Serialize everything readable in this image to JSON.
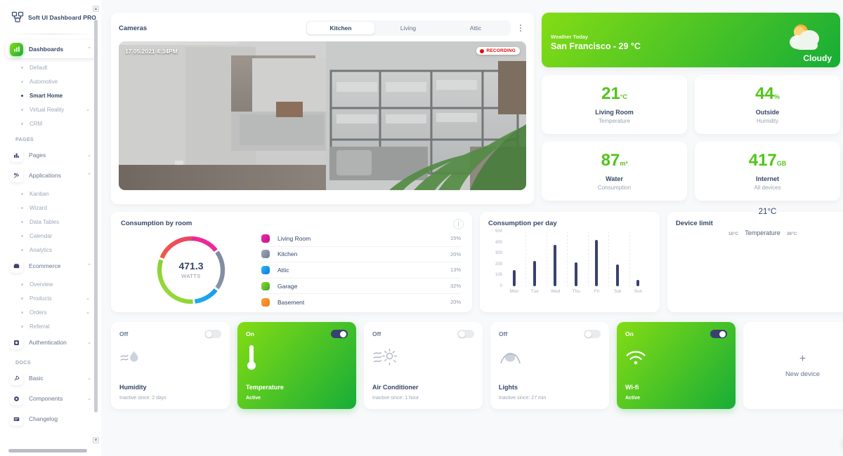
{
  "brand": {
    "name": "Soft UI Dashboard PRO",
    "logo_icon": "grid-logo-icon"
  },
  "sidebar": {
    "dashboards": {
      "label": "Dashboards",
      "icon": "dashboard-icon",
      "chevron": "⌃"
    },
    "dashboard_items": [
      {
        "label": "Default"
      },
      {
        "label": "Automotive"
      },
      {
        "label": "Smart Home"
      },
      {
        "label": "Virtual Reality",
        "chevron": "⌄"
      },
      {
        "label": "CRM"
      }
    ],
    "pages_section": "PAGES",
    "pages": {
      "label": "Pages",
      "icon": "pages-icon",
      "chevron": "⌄"
    },
    "applications": {
      "label": "Applications",
      "icon": "applications-icon",
      "chevron": "⌃"
    },
    "application_items": [
      {
        "label": "Kanban"
      },
      {
        "label": "Wizard"
      },
      {
        "label": "Data Tables"
      },
      {
        "label": "Calendar"
      },
      {
        "label": "Analytics"
      }
    ],
    "ecommerce": {
      "label": "Ecommerce",
      "icon": "ecommerce-icon",
      "chevron": "⌃"
    },
    "ecommerce_items": [
      {
        "label": "Overview"
      },
      {
        "label": "Products",
        "chevron": "⌄"
      },
      {
        "label": "Orders",
        "chevron": "⌄"
      },
      {
        "label": "Referral"
      }
    ],
    "authentication": {
      "label": "Authentication",
      "icon": "authentication-icon",
      "chevron": "⌄"
    },
    "docs_section": "DOCS",
    "basic": {
      "label": "Basic",
      "icon": "basic-icon",
      "chevron": "⌄"
    },
    "components": {
      "label": "Components",
      "icon": "components-icon",
      "chevron": "⌄"
    },
    "changelog": {
      "label": "Changelog",
      "icon": "changelog-icon"
    }
  },
  "cameras": {
    "title": "Cameras",
    "tabs": [
      {
        "label": "Kitchen",
        "active": true
      },
      {
        "label": "Living",
        "active": false
      },
      {
        "label": "Attic",
        "active": false
      }
    ],
    "timestamp": "17.05.2021 4:34PM",
    "recording_label": "RECORDING",
    "menu_icon": "kebab-menu-icon"
  },
  "weather": {
    "subtitle": "Weather Today",
    "headline": "San Francisco - 29 °C",
    "condition": "Cloudy",
    "icon": "sun-behind-cloud-icon",
    "accent": "#17ad37"
  },
  "stats": [
    {
      "value": "21",
      "unit": "°C",
      "name": "Living Room",
      "sub": "Temperature"
    },
    {
      "value": "44",
      "unit": "%",
      "name": "Outside",
      "sub": "Humidity"
    },
    {
      "value": "87",
      "unit": "m³",
      "name": "Water",
      "sub": "Consumption"
    },
    {
      "value": "417",
      "unit": "GB",
      "name": "Internet",
      "sub": "All devices"
    }
  ],
  "floating_temp": "21°C",
  "consumption_by_room": {
    "title": "Consumption by room",
    "info_icon": "info-icon",
    "center_value": "471.3",
    "center_unit": "WATTS"
  },
  "device_limit": {
    "title": "Device limit",
    "min": "16°C",
    "label": "Temperature",
    "max": "38°C"
  },
  "devices": [
    {
      "state": "Off",
      "on": false,
      "name": "Humidity",
      "note": "Inactive since: 2 days",
      "icon": "humidity-icon"
    },
    {
      "state": "On",
      "on": true,
      "name": "Temperature",
      "note": "Active",
      "icon": "thermometer-icon"
    },
    {
      "state": "Off",
      "on": false,
      "name": "Air Conditioner",
      "note": "Inactive since: 1 hour",
      "icon": "air-conditioner-icon"
    },
    {
      "state": "Off",
      "on": false,
      "name": "Lights",
      "note": "Inactive since: 27 min",
      "icon": "lights-icon"
    },
    {
      "state": "On",
      "on": true,
      "name": "Wi-fi",
      "note": "Active",
      "icon": "wifi-icon"
    }
  ],
  "new_device": {
    "label": "New device",
    "plus": "+"
  },
  "settings_fab": {
    "icon": "gear-icon"
  },
  "chart_data": [
    {
      "type": "pie",
      "title": "Consumption by room",
      "categories": [
        "Living Room",
        "Kitchen",
        "Attic",
        "Garage",
        "Basement"
      ],
      "values": [
        15,
        20,
        13,
        32,
        20
      ],
      "labels": [
        "15%",
        "20%",
        "13%",
        "32%",
        "20%"
      ],
      "colors": [
        "#e5188f",
        "#8392ab",
        "#1e9bf0",
        "#67c23a",
        "#f5841f"
      ],
      "center_value": "471.3",
      "center_unit": "WATTS",
      "legend": "right"
    },
    {
      "type": "bar",
      "title": "Consumption per day",
      "categories": [
        "Mon",
        "Tue",
        "Wed",
        "Thu",
        "Fri",
        "Sat",
        "Sun"
      ],
      "values": [
        150,
        230,
        380,
        220,
        420,
        200,
        60
      ],
      "xlabel": "",
      "ylabel": "",
      "ylim": [
        0,
        500
      ],
      "yticks": [
        0,
        100,
        200,
        300,
        400,
        500
      ],
      "grid": true,
      "bar_color": "#3a416f"
    }
  ]
}
